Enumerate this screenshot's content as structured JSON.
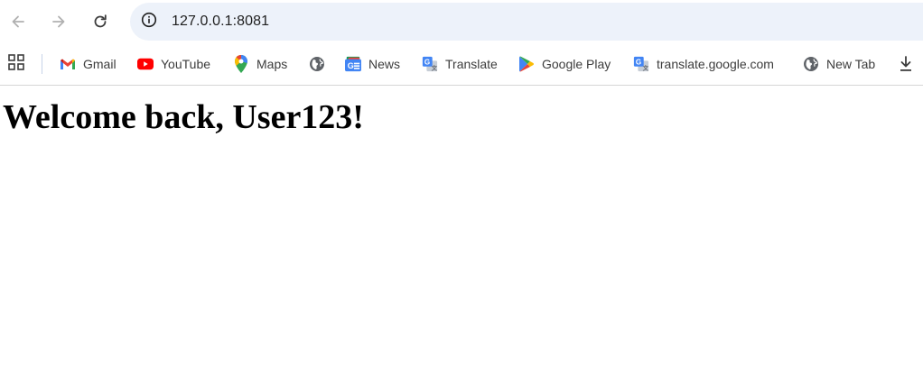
{
  "browser": {
    "url": "127.0.0.1:8081",
    "nav": {
      "back_icon": "arrow-left-icon",
      "forward_icon": "arrow-right-icon",
      "reload_icon": "reload-icon",
      "info_icon": "info-icon"
    }
  },
  "bookmarks": {
    "apps_icon": "apps-grid-icon",
    "items": [
      {
        "label": "Gmail",
        "icon": "gmail-icon"
      },
      {
        "label": "YouTube",
        "icon": "youtube-icon"
      },
      {
        "label": "Maps",
        "icon": "maps-icon"
      },
      {
        "label": "",
        "icon": "globe-icon"
      },
      {
        "label": "News",
        "icon": "news-icon"
      },
      {
        "label": "Translate",
        "icon": "translate-icon"
      },
      {
        "label": "Google Play",
        "icon": "google-play-icon"
      },
      {
        "label": "translate.google.com",
        "icon": "translate-icon"
      },
      {
        "label": "New Tab",
        "icon": "globe-icon"
      },
      {
        "label": "",
        "icon": "download-icon"
      }
    ]
  },
  "page": {
    "heading": "Welcome back, User123!"
  },
  "colors": {
    "omnibox_bg": "#edf2fa",
    "youtube_red": "#ff0000",
    "gmail_red": "#ea4335",
    "news_blue": "#4285f4"
  }
}
